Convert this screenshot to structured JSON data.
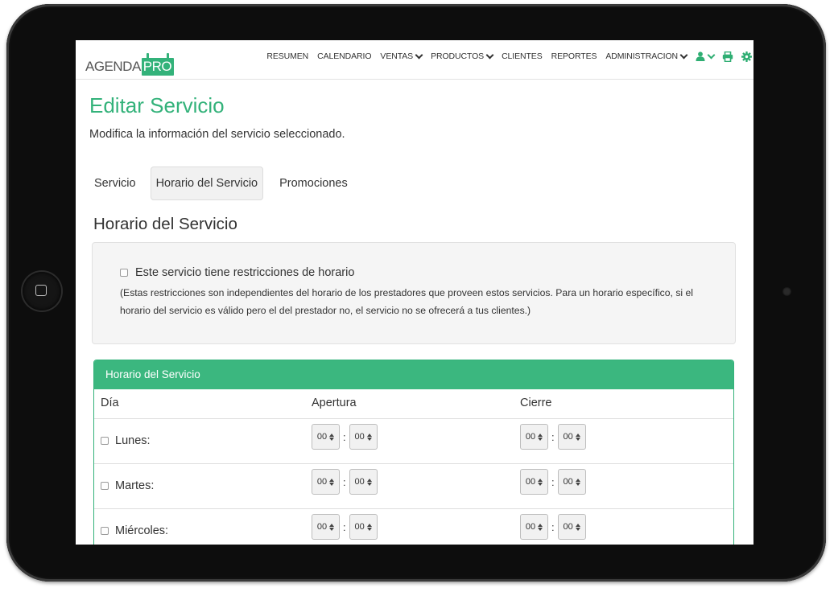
{
  "navbar": {
    "logo_left": "AGENDA",
    "logo_right": "PRO",
    "items": [
      {
        "label": "RESUMEN",
        "dropdown": false
      },
      {
        "label": "CALENDARIO",
        "dropdown": false
      },
      {
        "label": "VENTAS",
        "dropdown": true
      },
      {
        "label": "PRODUCTOS",
        "dropdown": true
      },
      {
        "label": "CLIENTES",
        "dropdown": false
      },
      {
        "label": "REPORTES",
        "dropdown": false
      },
      {
        "label": "ADMINISTRACION",
        "dropdown": true
      }
    ],
    "icons": [
      "user-icon",
      "print-icon",
      "gear-icon"
    ],
    "accent_color": "#2fae73"
  },
  "header": {
    "title": "Editar Servicio",
    "subtitle": "Modifica la información del servicio seleccionado."
  },
  "tabs": [
    {
      "label": "Servicio",
      "active": false
    },
    {
      "label": "Horario del Servicio",
      "active": true
    },
    {
      "label": "Promociones",
      "active": false
    }
  ],
  "section": {
    "title": "Horario del Servicio",
    "restriction_label": "Este servicio tiene restricciones de horario",
    "restriction_checked": false,
    "restriction_note": "(Estas restricciones son independientes del horario de los prestadores que proveen estos servicios. Para un horario específico, si el horario del servicio es válido pero el del prestador no, el servicio no se ofrecerá a tus clientes.)"
  },
  "schedule": {
    "panel_title": "Horario del Servicio",
    "columns": [
      "Día",
      "Apertura",
      "Cierre"
    ],
    "rows": [
      {
        "day": "Lunes:",
        "open_h": "00",
        "open_m": "00",
        "close_h": "00",
        "close_m": "00"
      },
      {
        "day": "Martes:",
        "open_h": "00",
        "open_m": "00",
        "close_h": "00",
        "close_m": "00"
      },
      {
        "day": "Miércoles:",
        "open_h": "00",
        "open_m": "00",
        "close_h": "00",
        "close_m": "00"
      }
    ],
    "separator": ":"
  },
  "colors": {
    "brand_green": "#33b27a",
    "panel_heading": "#3bb77f"
  }
}
